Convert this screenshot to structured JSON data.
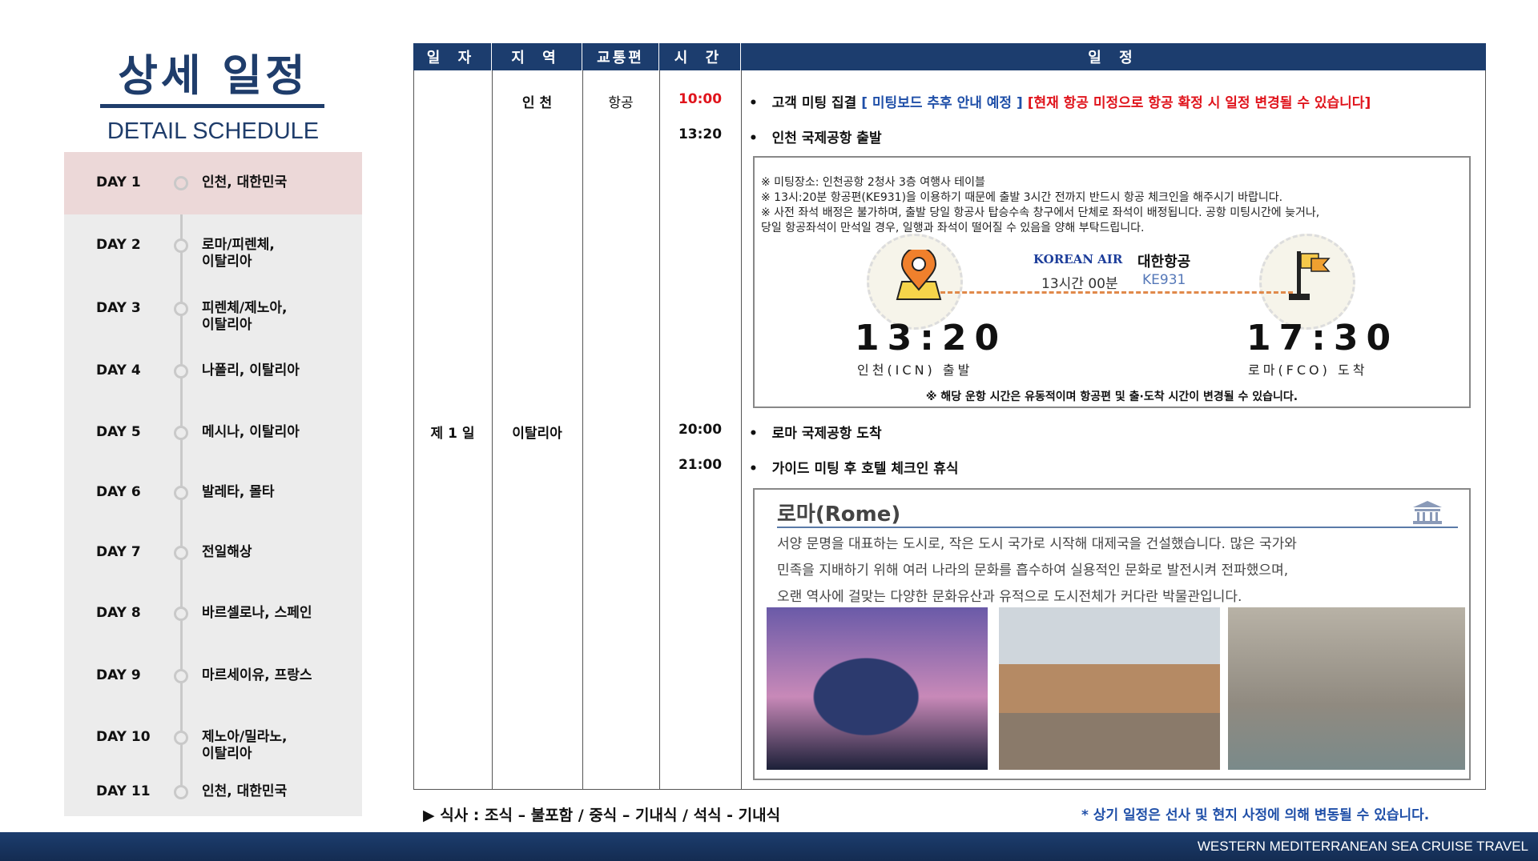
{
  "header": {
    "title": "상세 일정",
    "subtitle": "DETAIL SCHEDULE"
  },
  "sidebar": {
    "days": [
      {
        "label": "DAY 1",
        "place": "인천, 대한민국",
        "active": true
      },
      {
        "label": "DAY 2",
        "place": "로마/피렌체,\n이탈리아"
      },
      {
        "label": "DAY 3",
        "place": "피렌체/제노아,\n이탈리아"
      },
      {
        "label": "DAY 4",
        "place": "나폴리, 이탈리아"
      },
      {
        "label": "DAY 5",
        "place": "메시나, 이탈리아"
      },
      {
        "label": "DAY 6",
        "place": "발레타, 몰타"
      },
      {
        "label": "DAY 7",
        "place": "전일해상"
      },
      {
        "label": "DAY 8",
        "place": "바르셀로나, 스페인"
      },
      {
        "label": "DAY 9",
        "place": "마르세이유, 프랑스"
      },
      {
        "label": "DAY 10",
        "place": "제노아/밀라노,\n이탈리아"
      },
      {
        "label": "DAY 11",
        "place": "인천, 대한민국"
      }
    ]
  },
  "table": {
    "headers": [
      "일 자",
      "지 역",
      "교통편",
      "시 간",
      "일 정"
    ],
    "day": "제 1 일",
    "region1": "인 천",
    "region2": "이탈리아",
    "transport": "항공",
    "rows": [
      {
        "time": "10:00",
        "text": "고객 미팅 집결",
        "blue": "[ 미팅보드 추후 안내 예정 ]",
        "red": "[현재 항공 미정으로 항공 확정 시 일정 변경될 수 있습니다]"
      },
      {
        "time": "13:20",
        "text": "인천 국제공항 출발"
      },
      {
        "time": "20:00",
        "text": "로마 국제공항 도착"
      },
      {
        "time": "21:00",
        "text": "가이드 미팅 후 호텔 체크인 휴식"
      }
    ]
  },
  "flight": {
    "notes": [
      "※ 미팅장소: 인천공항 2청사 3층 여행사 테이블",
      "※ 13시:20분 항공편(KE931)을 이용하기 때문에 출발 3시간 전까지 반드시 항공 체크인을 해주시기 바랍니다.",
      "※ 사전 좌석 배정은 불가하며, 출발 당일 항공사 탑승수속 창구에서 단체로 좌석이 배정됩니다. 공항 미팅시간에 늦거나,",
      "당일 항공좌석이 만석일 경우, 일행과 좌석이 떨어질 수 있음을 양해 부탁드립니다."
    ],
    "airline_logo": "KOREAN AIR",
    "airline": "대한항공",
    "duration": "13시간 00분",
    "flight_no": "KE931",
    "dep_time": "13:20",
    "dep_place": "인천(ICN) 출발",
    "arr_time": "17:30",
    "arr_place": "로마(FCO) 도착",
    "disclaimer": "※ 해당 운항 시간은 유동적이며 항공편 및 출·도착 시간이 변경될 수 있습니다."
  },
  "rome": {
    "title": "로마(Rome)",
    "lines": [
      "서양 문명을 대표하는 도시로, 작은 도시 국가로 시작해 대제국을 건설했습니다. 많은 국가와",
      "민족을 지배하기 위해 여러 나라의 문화를 흡수하여 실용적인 문화로 발전시켜 전파했으며,",
      "오랜 역사에 걸맞는 다양한 문화유산과 유적으로 도시전체가 커다란 박물관입니다."
    ]
  },
  "footer": {
    "meal": "▶ 식사 : 조식 – 불포함 / 중식 – 기내식 / 석식 - 기내식",
    "notice": "* 상기 일정은 선사 및 현지 사정에 의해 변동될 수 있습니다.",
    "brand": "WESTERN MEDITERRANEAN SEA CRUISE TRAVEL"
  },
  "colors": {
    "navy": "#1c3d6e",
    "blue": "#1f4fa8",
    "red": "#e0141c",
    "highlight": "#ecd8d8"
  }
}
